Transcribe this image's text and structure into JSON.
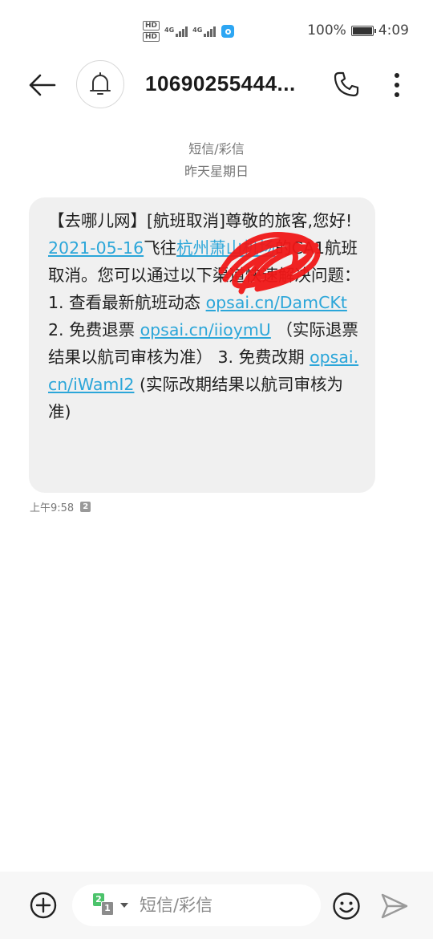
{
  "status_bar": {
    "hd1": "HD",
    "hd2": "HD",
    "net1": "4G",
    "net2": "4G",
    "battery_percent": "100%",
    "time": "4:09"
  },
  "header": {
    "contact": "10690255444...",
    "icons": [
      "back-arrow-icon",
      "bell-icon",
      "phone-icon",
      "more-vert-icon"
    ]
  },
  "thread": {
    "type_label": "短信/彩信",
    "date_label": "昨天星期日"
  },
  "message": {
    "t1": "【去哪儿网】[航班取消]尊敬的旅客,您好!",
    "date_link": "2021-05-16",
    "t2": "飞往",
    "airport_link": "杭州萧山机场",
    "t3": "的CA1",
    "t4": "航班取消。您可以通过以下渠道快速解决问题： 1. 查看最新航班动态 ",
    "link1": "opsai.cn/DamCKt",
    "t5": " 2. 免费退票 ",
    "link2": "opsai.cn/iioymU",
    "t6": " （实际退票结果以航司审核为准） 3. 免费改期 ",
    "link3": "opsai.cn/iWamI2",
    "t7": " (实际改期结果以航司审核为准)",
    "time": "上午9:58",
    "sim": "2"
  },
  "composer": {
    "sim_active": "2",
    "sim_other": "1",
    "placeholder": "短信/彩信",
    "icons": [
      "add-circle-icon",
      "sim-select-icon",
      "emoji-icon",
      "send-icon"
    ]
  },
  "colors": {
    "link": "#2ba6d9",
    "bubble": "#f0f0f0",
    "scribble": "#f01818"
  }
}
